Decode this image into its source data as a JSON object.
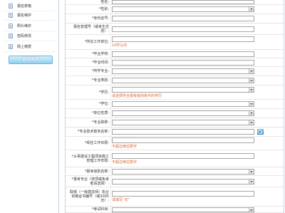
{
  "sidebar": {
    "items": [
      {
        "label": "报名表格",
        "icon": "document-icon"
      },
      {
        "label": "报名维护",
        "icon": "document-icon"
      },
      {
        "label": "照片维护",
        "icon": "document-icon"
      },
      {
        "label": "密码修改",
        "icon": "document-icon"
      },
      {
        "label": "网上缴费",
        "icon": "document-icon"
      }
    ],
    "logout_label": "退出系统"
  },
  "form": {
    "rows": [
      {
        "label": "姓名:"
      },
      {
        "label": "*性别:"
      },
      {
        "label": "*身份证号:"
      },
      {
        "label": "报名管理号（或考生志愿）:"
      },
      {
        "label": "*所在工作单位:",
        "hint": "14字以内"
      },
      {
        "label": "*毕业学校:"
      },
      {
        "label": "*毕业时间:"
      },
      {
        "label": "*所学专业:"
      },
      {
        "label": "*专业类别:"
      },
      {
        "label": "*学历:",
        "hint": "请选择符合报考级别条件的学历"
      },
      {
        "label": "*学位:"
      },
      {
        "label": "*单位性质:"
      },
      {
        "label": "*专业职称:"
      },
      {
        "label": "*专业技术职务名称:",
        "icon": "lookup-icon"
      },
      {
        "label": "*现任工作年限:",
        "hint": "不超过两位数字"
      },
      {
        "label": "*从事建设工程项目施工管理工作年限:",
        "hint": "不超过两位数字"
      },
      {
        "label": "*报考级别名称:"
      },
      {
        "label": "*报考专业（增项或免考者请选择）:"
      },
      {
        "label": "取得（一级建造师）执业资格证书编号（或2005年）:",
        "hint": "请填写“无”"
      },
      {
        "label": "*考试科目:"
      }
    ]
  },
  "colors": {
    "hint": "#e0662e",
    "button": "#8fcfee",
    "border": "#c6d3e0"
  }
}
